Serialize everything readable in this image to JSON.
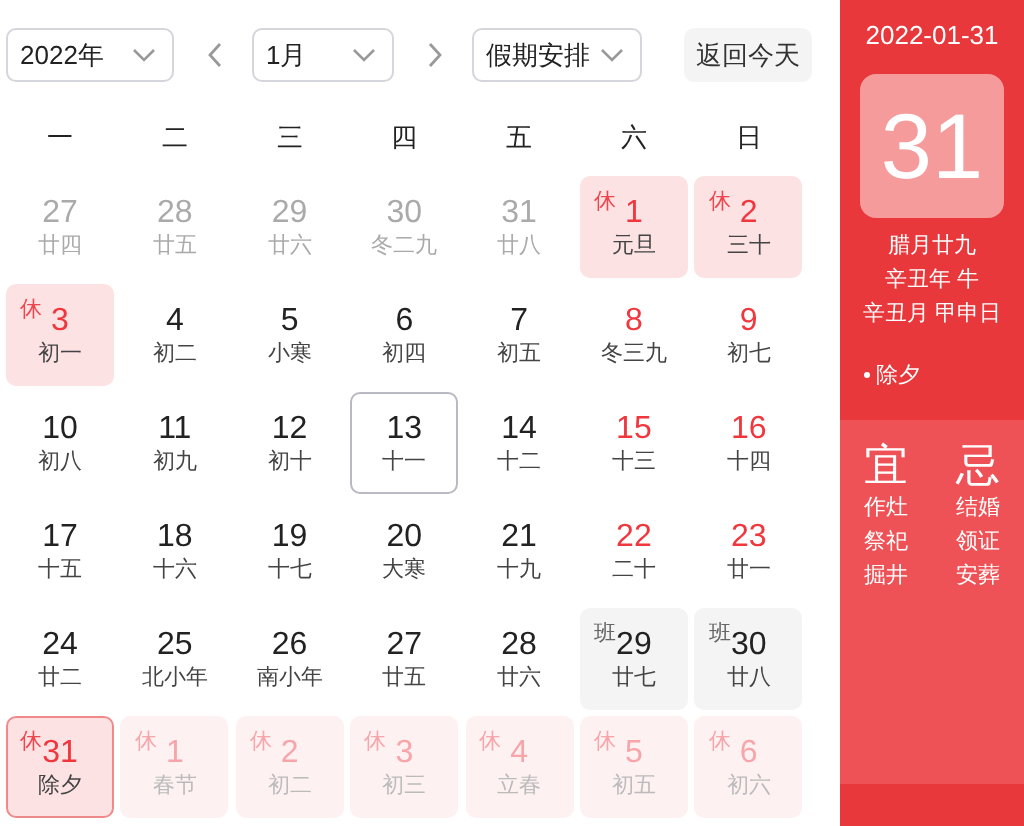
{
  "toolbar": {
    "year_select": "2022年",
    "month_select": "1月",
    "holiday_select": "假期安排",
    "today_button": "返回今天"
  },
  "weekdays": [
    "一",
    "二",
    "三",
    "四",
    "五",
    "六",
    "日"
  ],
  "days": [
    {
      "day": "27",
      "lunar": "廿四",
      "in_month": false,
      "red": false,
      "selected": false,
      "today": false
    },
    {
      "day": "28",
      "lunar": "廿五",
      "in_month": false,
      "red": false,
      "selected": false,
      "today": false
    },
    {
      "day": "29",
      "lunar": "廿六",
      "in_month": false,
      "red": false,
      "selected": false,
      "today": false
    },
    {
      "day": "30",
      "lunar": "冬二九",
      "in_month": false,
      "red": false,
      "selected": false,
      "today": false
    },
    {
      "day": "31",
      "lunar": "廿八",
      "in_month": false,
      "red": false,
      "selected": false,
      "today": false
    },
    {
      "day": "1",
      "lunar": "元旦",
      "tag": "休",
      "kind": "rest",
      "in_month": true,
      "red": true,
      "selected": false,
      "today": false
    },
    {
      "day": "2",
      "lunar": "三十",
      "tag": "休",
      "kind": "rest",
      "in_month": true,
      "red": true,
      "selected": false,
      "today": false
    },
    {
      "day": "3",
      "lunar": "初一",
      "tag": "休",
      "kind": "rest",
      "in_month": true,
      "red": true,
      "selected": false,
      "today": false
    },
    {
      "day": "4",
      "lunar": "初二",
      "in_month": true,
      "red": false,
      "selected": false,
      "today": false
    },
    {
      "day": "5",
      "lunar": "小寒",
      "in_month": true,
      "red": false,
      "selected": false,
      "today": false
    },
    {
      "day": "6",
      "lunar": "初四",
      "in_month": true,
      "red": false,
      "selected": false,
      "today": false
    },
    {
      "day": "7",
      "lunar": "初五",
      "in_month": true,
      "red": false,
      "selected": false,
      "today": false
    },
    {
      "day": "8",
      "lunar": "冬三九",
      "in_month": true,
      "red": true,
      "selected": false,
      "today": false
    },
    {
      "day": "9",
      "lunar": "初七",
      "in_month": true,
      "red": true,
      "selected": false,
      "today": false
    },
    {
      "day": "10",
      "lunar": "初八",
      "in_month": true,
      "red": false,
      "selected": false,
      "today": false
    },
    {
      "day": "11",
      "lunar": "初九",
      "in_month": true,
      "red": false,
      "selected": false,
      "today": false
    },
    {
      "day": "12",
      "lunar": "初十",
      "in_month": true,
      "red": false,
      "selected": false,
      "today": false
    },
    {
      "day": "13",
      "lunar": "十一",
      "in_month": true,
      "red": false,
      "selected": false,
      "today": true
    },
    {
      "day": "14",
      "lunar": "十二",
      "in_month": true,
      "red": false,
      "selected": false,
      "today": false
    },
    {
      "day": "15",
      "lunar": "十三",
      "in_month": true,
      "red": true,
      "selected": false,
      "today": false
    },
    {
      "day": "16",
      "lunar": "十四",
      "in_month": true,
      "red": true,
      "selected": false,
      "today": false
    },
    {
      "day": "17",
      "lunar": "十五",
      "in_month": true,
      "red": false,
      "selected": false,
      "today": false
    },
    {
      "day": "18",
      "lunar": "十六",
      "in_month": true,
      "red": false,
      "selected": false,
      "today": false
    },
    {
      "day": "19",
      "lunar": "十七",
      "in_month": true,
      "red": false,
      "selected": false,
      "today": false
    },
    {
      "day": "20",
      "lunar": "大寒",
      "in_month": true,
      "red": false,
      "selected": false,
      "today": false
    },
    {
      "day": "21",
      "lunar": "十九",
      "in_month": true,
      "red": false,
      "selected": false,
      "today": false
    },
    {
      "day": "22",
      "lunar": "二十",
      "in_month": true,
      "red": true,
      "selected": false,
      "today": false
    },
    {
      "day": "23",
      "lunar": "廿一",
      "in_month": true,
      "red": true,
      "selected": false,
      "today": false
    },
    {
      "day": "24",
      "lunar": "廿二",
      "in_month": true,
      "red": false,
      "selected": false,
      "today": false
    },
    {
      "day": "25",
      "lunar": "北小年",
      "in_month": true,
      "red": false,
      "selected": false,
      "today": false
    },
    {
      "day": "26",
      "lunar": "南小年",
      "in_month": true,
      "red": false,
      "selected": false,
      "today": false
    },
    {
      "day": "27",
      "lunar": "廿五",
      "in_month": true,
      "red": false,
      "selected": false,
      "today": false
    },
    {
      "day": "28",
      "lunar": "廿六",
      "in_month": true,
      "red": false,
      "selected": false,
      "today": false
    },
    {
      "day": "29",
      "lunar": "廿七",
      "tag": "班",
      "kind": "work",
      "in_month": true,
      "red": false,
      "selected": false,
      "today": false
    },
    {
      "day": "30",
      "lunar": "廿八",
      "tag": "班",
      "kind": "work",
      "in_month": true,
      "red": false,
      "selected": false,
      "today": false
    },
    {
      "day": "31",
      "lunar": "除夕",
      "tag": "休",
      "kind": "rest",
      "in_month": true,
      "red": true,
      "selected": true,
      "today": false
    },
    {
      "day": "1",
      "lunar": "春节",
      "tag": "休",
      "kind": "rest",
      "in_month": false,
      "red": true,
      "selected": false,
      "today": false
    },
    {
      "day": "2",
      "lunar": "初二",
      "tag": "休",
      "kind": "rest",
      "in_month": false,
      "red": true,
      "selected": false,
      "today": false
    },
    {
      "day": "3",
      "lunar": "初三",
      "tag": "休",
      "kind": "rest",
      "in_month": false,
      "red": true,
      "selected": false,
      "today": false
    },
    {
      "day": "4",
      "lunar": "立春",
      "tag": "休",
      "kind": "rest",
      "in_month": false,
      "red": true,
      "selected": false,
      "today": false
    },
    {
      "day": "5",
      "lunar": "初五",
      "tag": "休",
      "kind": "rest",
      "in_month": false,
      "red": true,
      "selected": false,
      "today": false
    },
    {
      "day": "6",
      "lunar": "初六",
      "tag": "休",
      "kind": "rest",
      "in_month": false,
      "red": true,
      "selected": false,
      "today": false
    }
  ],
  "detail": {
    "date": "2022-01-31",
    "big_day": "31",
    "lunar_lines": [
      "腊月廿九",
      "辛丑年 牛",
      "辛丑月 甲申日"
    ],
    "festival": "除夕",
    "good_title": "宜",
    "good": [
      "作灶",
      "祭祀",
      "掘井"
    ],
    "bad_title": "忌",
    "bad": [
      "结婚",
      "领证",
      "安葬"
    ]
  }
}
